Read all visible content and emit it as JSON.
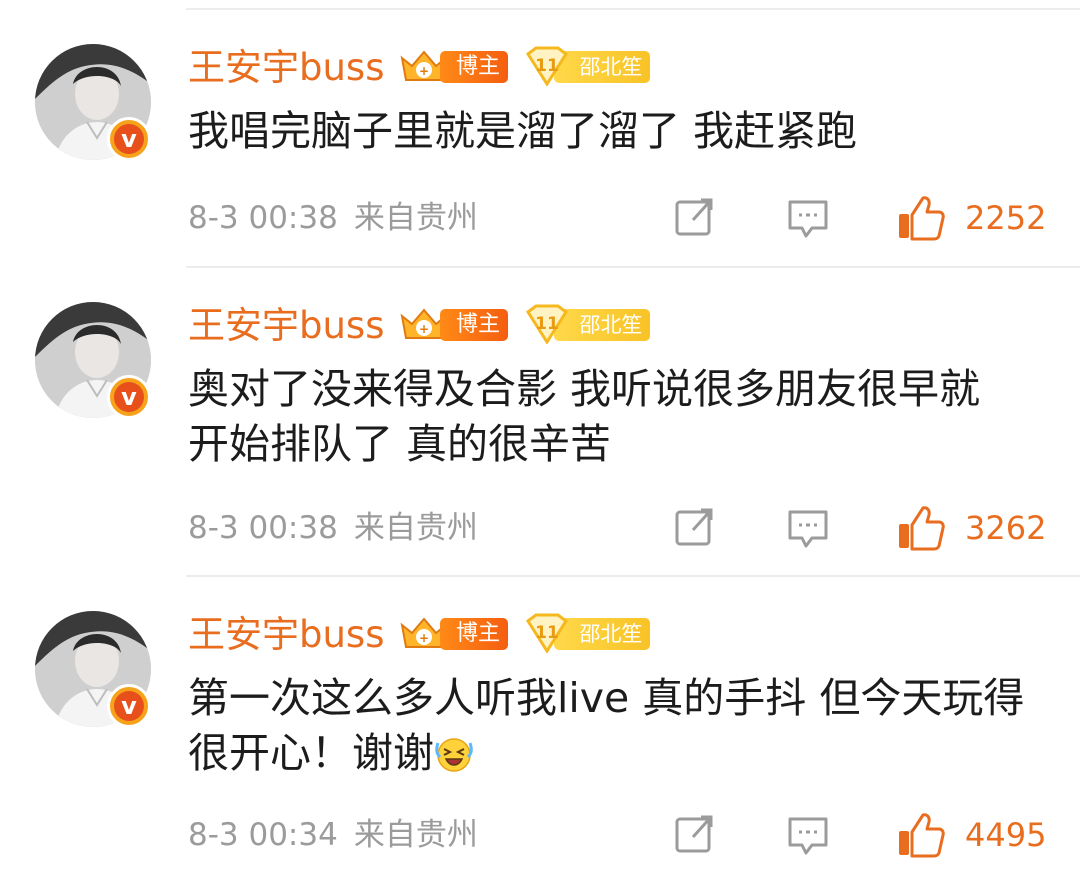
{
  "comments": [
    {
      "author": "王安宇buss",
      "host_badge": "博主",
      "fan_level": "11",
      "fan_badge": "邵北笙",
      "text": "我唱完脑子里就是溜了溜了 我赶紧跑",
      "time": "8-3 00:38",
      "location": "来自贵州",
      "likes": "2252"
    },
    {
      "author": "王安宇buss",
      "host_badge": "博主",
      "fan_level": "11",
      "fan_badge": "邵北笙",
      "text": "奥对了没来得及合影 我听说很多朋友很早就开始排队了 真的很辛苦",
      "time": "8-3 00:38",
      "location": "来自贵州",
      "likes": "3262"
    },
    {
      "author": "王安宇buss",
      "host_badge": "博主",
      "fan_level": "11",
      "fan_badge": "邵北笙",
      "text": "第一次这么多人听我live 真的手抖 但今天玩得很开心！谢谢",
      "time": "8-3 00:34",
      "location": "来自贵州",
      "likes": "4495"
    }
  ],
  "icons": {
    "verified": "verified-v-icon",
    "share": "share-icon",
    "reply": "comment-icon",
    "like": "thumbs-up-icon",
    "emoji": "laughing-crying-emoji"
  },
  "colors": {
    "name": "#e86d1f",
    "meta": "#9b9b9b",
    "like": "#e86d1f",
    "host_badge": "#f97a16",
    "fan_badge": "#fbcb36"
  }
}
